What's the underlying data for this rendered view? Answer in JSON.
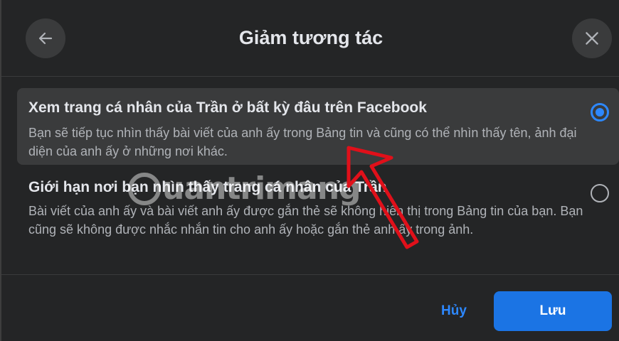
{
  "dialog": {
    "title": "Giảm tương tác"
  },
  "icons": {
    "back": "arrow-left-icon",
    "close": "close-icon"
  },
  "options": [
    {
      "title": "Xem trang cá nhân của Trần ở bất kỳ đâu trên Facebook",
      "description": "Bạn sẽ tiếp tục nhìn thấy bài viết của anh ấy trong Bảng tin và cũng có thể nhìn thấy tên, ảnh đại diện của anh ấy ở những nơi khác.",
      "selected": true
    },
    {
      "title": "Giới hạn nơi bạn nhìn thấy trang cá nhân của Trần",
      "description": "Bài viết của anh ấy và bài viết anh ấy được gắn thẻ sẽ không hiển thị trong Bảng tin của bạn. Bạn cũng sẽ không được nhắc nhắn tin cho anh ấy hoặc gắn thẻ anh ấy trong ảnh.",
      "selected": false
    }
  ],
  "footer": {
    "cancel_label": "Hủy",
    "save_label": "Lưu"
  },
  "watermark": {
    "text": "uantrimang"
  },
  "colors": {
    "background": "#242526",
    "surface": "#3a3b3c",
    "accent": "#2d88ff",
    "primary_button": "#1b74e4",
    "text_primary": "#e4e6eb",
    "text_secondary": "#b0b3b8",
    "annotation_arrow": "#e0101a"
  }
}
